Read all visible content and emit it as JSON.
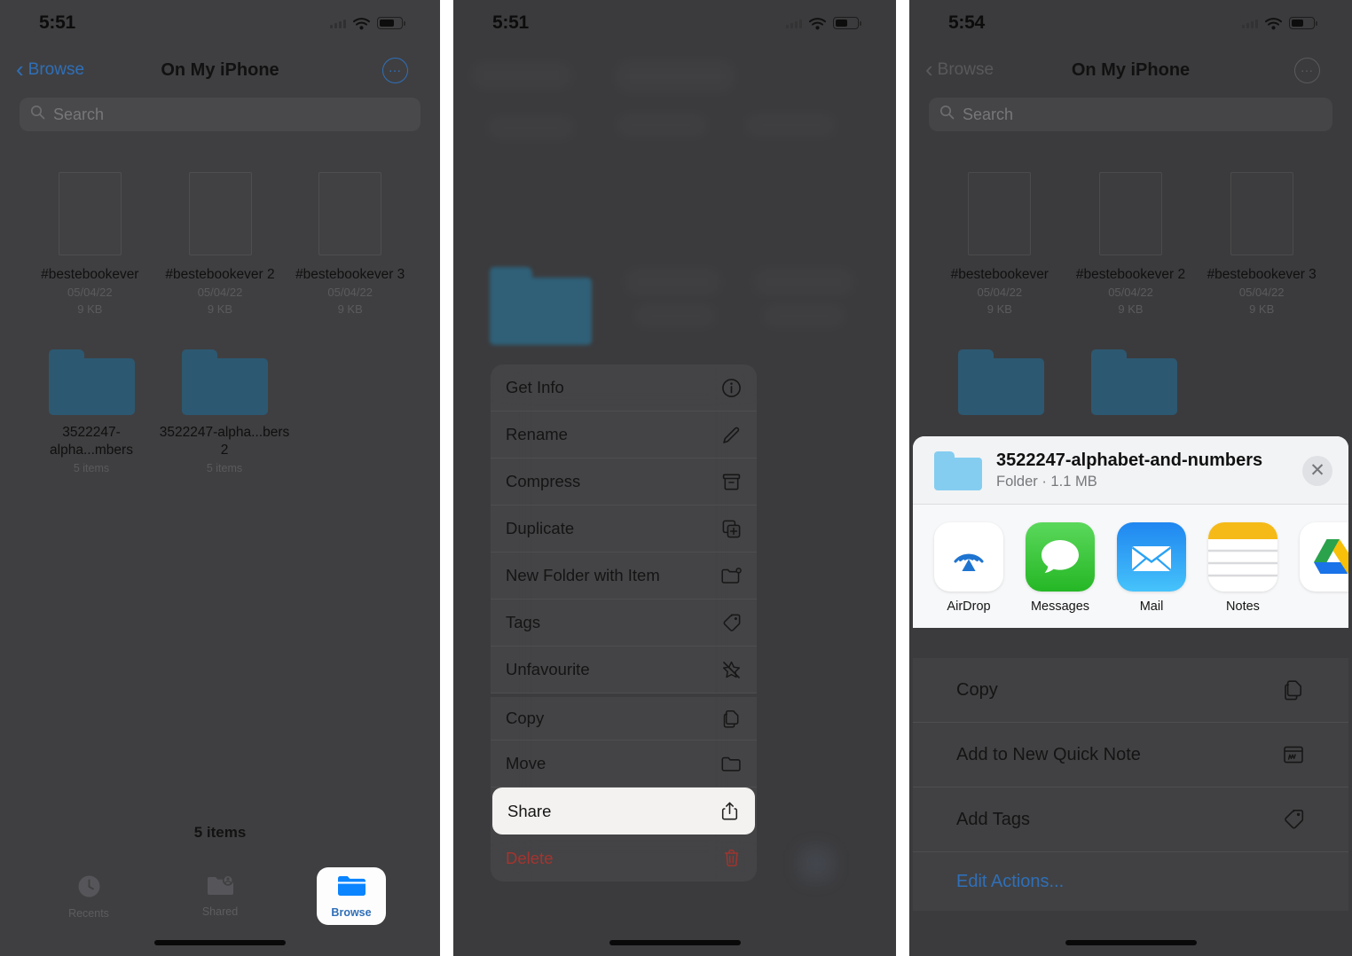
{
  "panels": [
    {
      "id": "files-browse",
      "statusbar": {
        "time": "5:51",
        "wifi": "wifi-icon",
        "battery": "battery-icon"
      },
      "nav": {
        "back": "Browse",
        "title": "On My iPhone",
        "more": "more-options-icon"
      },
      "search": {
        "placeholder": "Search",
        "icon": "search-icon"
      },
      "files": [
        {
          "name": "#bestebookever",
          "date": "05/04/22",
          "size": "9 KB"
        },
        {
          "name": "#bestebookever 2",
          "date": "05/04/22",
          "size": "9 KB"
        },
        {
          "name": "#bestebookever 3",
          "date": "05/04/22",
          "size": "9 KB"
        }
      ],
      "folders": [
        {
          "name": "3522247-alpha...mbers",
          "meta": "5 items"
        },
        {
          "name": "3522247-alpha...bers 2",
          "meta": "5 items"
        }
      ],
      "items_count": "5 items",
      "tabs": [
        {
          "label": "Recents",
          "icon": "clock-icon",
          "active": false
        },
        {
          "label": "Shared",
          "icon": "shared-folder-icon",
          "active": false
        },
        {
          "label": "Browse",
          "icon": "folder-icon",
          "active": true
        }
      ]
    },
    {
      "id": "context-menu",
      "statusbar": {
        "time": "5:51"
      },
      "menu": [
        {
          "label": "Get Info",
          "icon": "info-circle-icon",
          "style": "normal"
        },
        {
          "label": "Rename",
          "icon": "pencil-icon",
          "style": "normal"
        },
        {
          "label": "Compress",
          "icon": "archive-box-icon",
          "style": "normal"
        },
        {
          "label": "Duplicate",
          "icon": "duplicate-icon",
          "style": "normal"
        },
        {
          "label": "New Folder with Item",
          "icon": "new-folder-icon",
          "style": "normal"
        },
        {
          "label": "Tags",
          "icon": "tag-icon",
          "style": "normal"
        },
        {
          "label": "Unfavourite",
          "icon": "star-slash-icon",
          "style": "normal"
        },
        {
          "label": "Copy",
          "icon": "copy-icon",
          "style": "group"
        },
        {
          "label": "Move",
          "icon": "folder-icon",
          "style": "normal"
        },
        {
          "label": "Share",
          "icon": "share-icon",
          "style": "highlight"
        },
        {
          "label": "Delete",
          "icon": "trash-icon",
          "style": "danger"
        }
      ]
    },
    {
      "id": "share-sheet",
      "statusbar": {
        "time": "5:54"
      },
      "nav": {
        "back": "Browse",
        "title": "On My iPhone",
        "more": "more-options-icon"
      },
      "search": {
        "placeholder": "Search",
        "icon": "search-icon"
      },
      "files": [
        {
          "name": "#bestebookever",
          "date": "05/04/22",
          "size": "9 KB"
        },
        {
          "name": "#bestebookever 2",
          "date": "05/04/22",
          "size": "9 KB"
        },
        {
          "name": "#bestebookever 3",
          "date": "05/04/22",
          "size": "9 KB"
        }
      ],
      "sheet": {
        "title": "3522247-alphabet-and-numbers",
        "subtitle": "Folder · 1.1 MB",
        "close": "close-icon",
        "apps": [
          {
            "label": "AirDrop",
            "icon": "airdrop-icon"
          },
          {
            "label": "Messages",
            "icon": "messages-icon"
          },
          {
            "label": "Mail",
            "icon": "mail-icon"
          },
          {
            "label": "Notes",
            "icon": "notes-icon"
          },
          {
            "label": "",
            "icon": "google-drive-icon"
          }
        ],
        "actions": [
          {
            "label": "Copy",
            "icon": "copy-icon",
            "style": "normal"
          },
          {
            "label": "Add to New Quick Note",
            "icon": "quick-note-icon",
            "style": "normal"
          },
          {
            "label": "Add Tags",
            "icon": "tag-icon",
            "style": "normal"
          },
          {
            "label": "Edit Actions...",
            "icon": "",
            "style": "link"
          }
        ]
      }
    }
  ],
  "colors": {
    "accent": "#2f6fb8",
    "danger": "#a5342e",
    "folder_dim": "#2d5871",
    "folder_light": "#84cdf0",
    "background": "#3a3a3c",
    "sheet_bg": "#f2f3f5"
  }
}
